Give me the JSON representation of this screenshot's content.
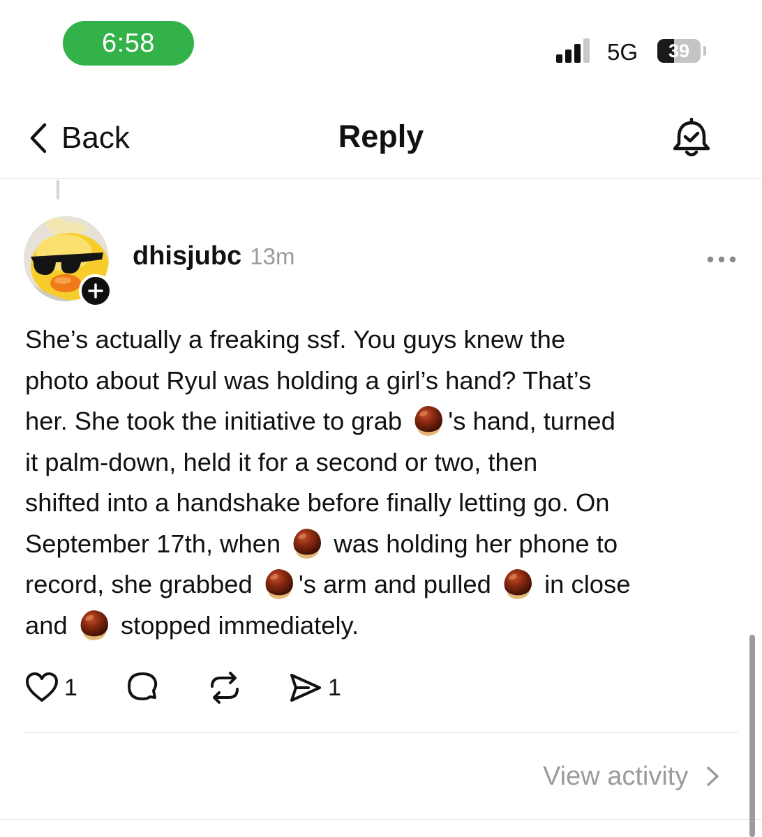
{
  "status_bar": {
    "time": "6:58",
    "network": "5G",
    "battery": "39",
    "battery_level_percent": 39,
    "signal_bars_active": 3,
    "signal_bars_total": 4,
    "time_pill_color": "#34b24a"
  },
  "nav": {
    "back_label": "Back",
    "title": "Reply",
    "right_icon": "bell-check-icon"
  },
  "post": {
    "username": "dhisjubc",
    "timestamp": "13m",
    "avatar_icon": "duck-sunglasses-avatar",
    "follow_icon": "plus-icon",
    "more_icon": "ellipsis-icon",
    "body_emoji_icon": "chestnut-emoji",
    "body_segments": {
      "l1": "She’s actually a freaking ssf. You guys knew the",
      "l2": "photo about Ryul was holding a girl’s hand? That’s",
      "l3a": "her. She took the initiative to grab",
      "l3b": "'s hand, turned",
      "l4": "it palm-down, held it for a second or two, then",
      "l5": "shifted into a handshake before finally letting go. On",
      "l6a": "September 17th, when",
      "l6b": "was holding her phone to",
      "l7a": "record, she grabbed",
      "l7b": "'s arm and pulled",
      "l7c": "in close",
      "l8a": "and",
      "l8b": "stopped immediately."
    },
    "actions": {
      "like_icon": "heart-icon",
      "like_count": "1",
      "comment_icon": "comment-icon",
      "repost_icon": "repost-icon",
      "share_icon": "send-icon",
      "share_count": "1"
    },
    "view_activity": "View activity",
    "view_activity_icon": "chevron-right-icon"
  }
}
